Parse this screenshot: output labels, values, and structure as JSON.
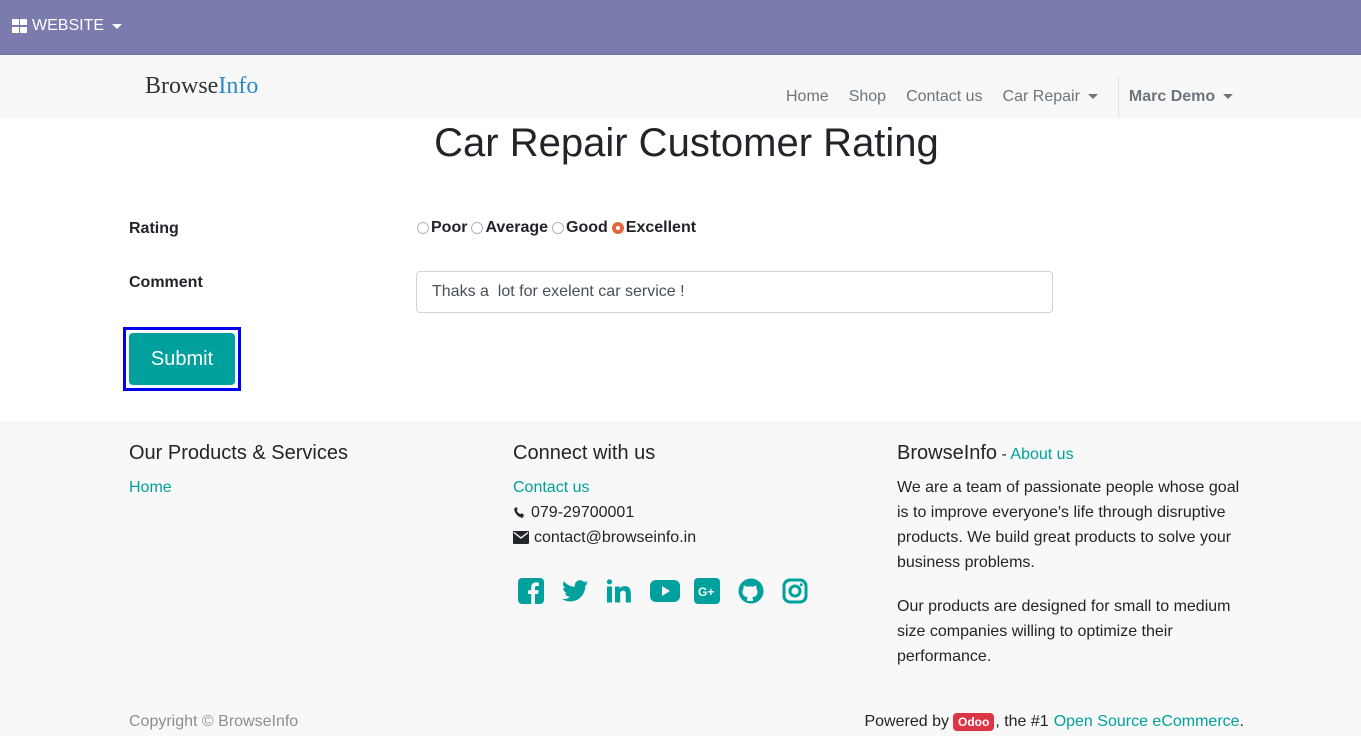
{
  "admin_bar": {
    "menu_label": "WEBSITE",
    "menu_icon": "grid-icon",
    "color": "#7c7bad"
  },
  "navbar": {
    "brand_part1": "Browse",
    "brand_part2": "Info",
    "links": [
      "Home",
      "Shop",
      "Contact us",
      "Car Repair"
    ],
    "user_label": "Marc Demo"
  },
  "form": {
    "title": "Car Repair Customer Rating",
    "rating_label": "Rating",
    "rating_options": [
      "Poor",
      "Average",
      "Good",
      "Excellent"
    ],
    "rating_selected": "Excellent",
    "comment_label": "Comment",
    "comment_value": "Thaks a  lot for exelent car service !",
    "submit_label": "Submit",
    "accent_color": "#00a09d"
  },
  "footer": {
    "col1": {
      "heading": "Our Products & Services",
      "links": [
        "Home"
      ]
    },
    "col2": {
      "heading": "Connect with us",
      "contact_link": "Contact us",
      "phone": "079-29700001",
      "email": "contact@browseinfo.in",
      "social_icons": [
        "facebook-icon",
        "twitter-icon",
        "linkedin-icon",
        "youtube-icon",
        "google-plus-icon",
        "github-icon",
        "instagram-icon"
      ]
    },
    "col3": {
      "heading": "BrowseInfo",
      "separator": " - ",
      "about_link": "About us",
      "para1": "We are a team of passionate people whose goal is to improve everyone's life through disruptive products. We build great products to solve your business problems.",
      "para2": "Our products are designed for small to medium size companies willing to optimize their performance."
    },
    "copyright": "Copyright © BrowseInfo",
    "powered_by": "Powered by",
    "odoo_badge": "Odoo",
    "powered_mid": ", the #1",
    "powered_link": "Open Source eCommerce",
    "powered_end": "."
  }
}
